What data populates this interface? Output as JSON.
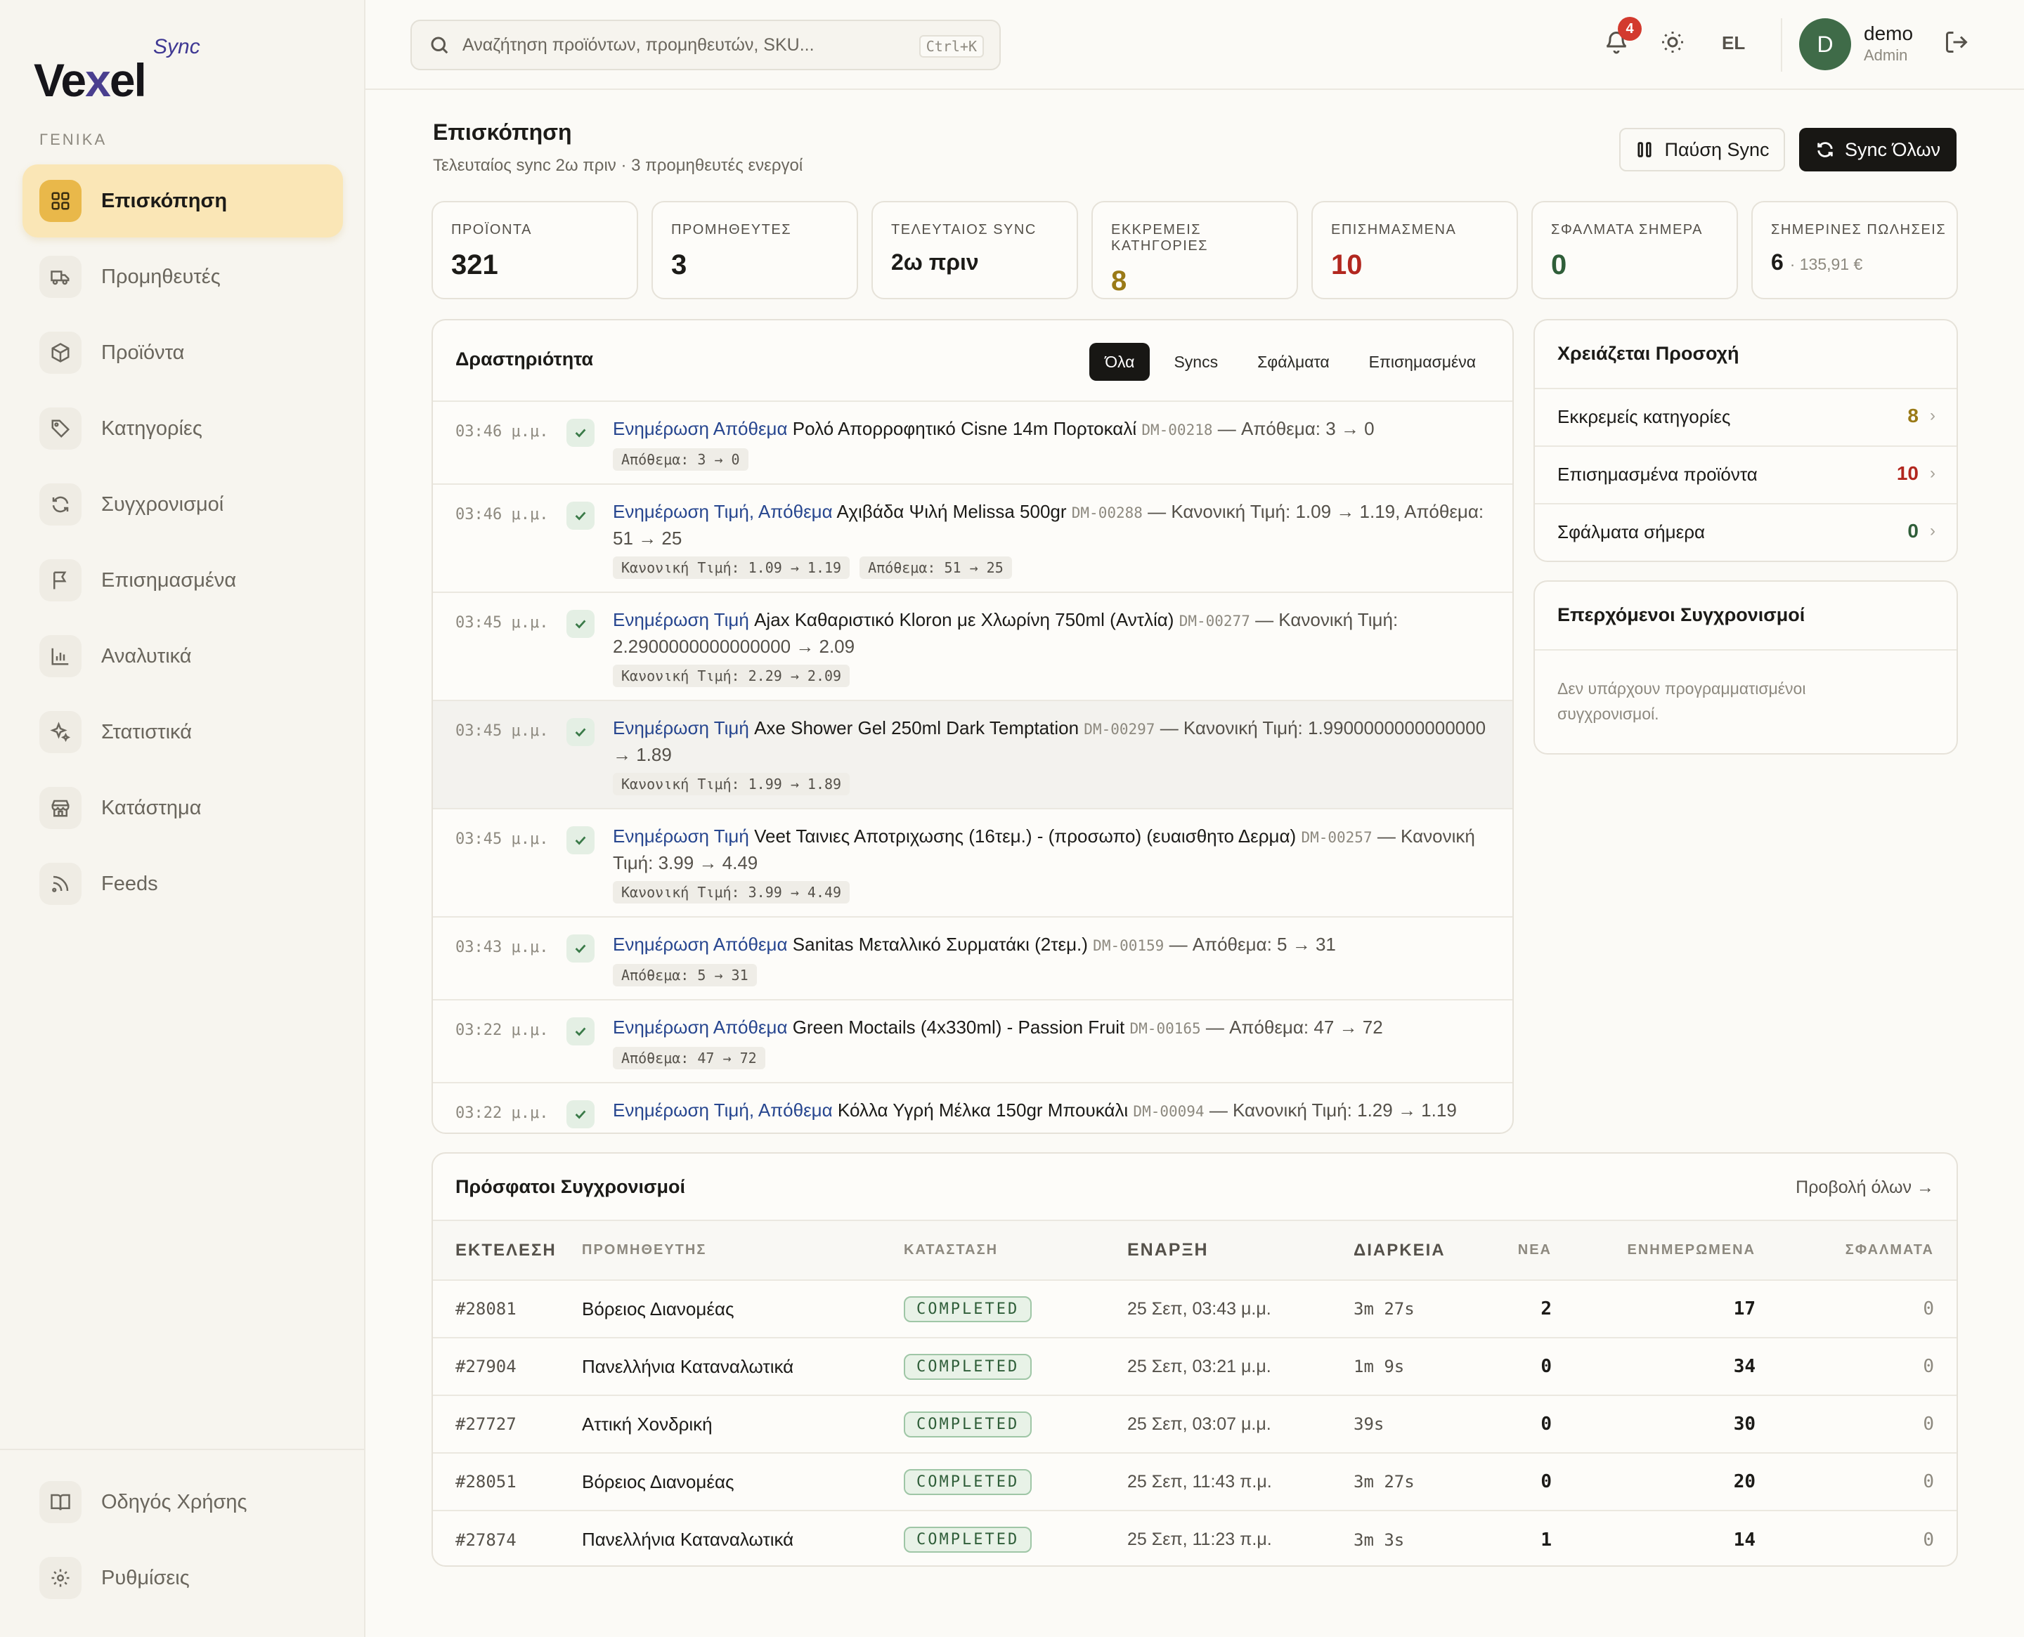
{
  "app": {
    "brand": "Vexel",
    "brand_suffix": "Sync"
  },
  "sidebar": {
    "section": "ΓΕΝΙΚΑ",
    "items": [
      {
        "label": "Επισκόπηση",
        "icon": "grid-icon"
      },
      {
        "label": "Προμηθευτές",
        "icon": "truck-icon"
      },
      {
        "label": "Προϊόντα",
        "icon": "box-icon"
      },
      {
        "label": "Κατηγορίες",
        "icon": "tag-icon"
      },
      {
        "label": "Συγχρονισμοί",
        "icon": "refresh-icon"
      },
      {
        "label": "Επισημασμένα",
        "icon": "flag-icon"
      },
      {
        "label": "Αναλυτικά",
        "icon": "bar-chart-icon"
      },
      {
        "label": "Στατιστικά",
        "icon": "sparkle-icon"
      },
      {
        "label": "Κατάστημα",
        "icon": "store-icon"
      },
      {
        "label": "Feeds",
        "icon": "rss-icon"
      }
    ],
    "bottom": [
      {
        "label": "Οδηγός Χρήσης",
        "icon": "book-icon"
      },
      {
        "label": "Ρυθμίσεις",
        "icon": "gear-icon"
      }
    ]
  },
  "topbar": {
    "search_placeholder": "Αναζήτηση προϊόντων, προμηθευτών, SKU...",
    "search_shortcut": "Ctrl+K",
    "notification_count": "4",
    "language": "EL",
    "avatar_initial": "D",
    "user_name": "demo",
    "user_role": "Admin"
  },
  "header": {
    "title": "Επισκόπηση",
    "subtitle": "Τελευταίος sync 2ω πριν · 3 προμηθευτές ενεργοί",
    "pause_label": "Παύση Sync",
    "sync_all_label": "Sync Όλων"
  },
  "stats": [
    {
      "label": "ΠΡΟΪΟΝΤΑ",
      "value": "321",
      "color": "#1c1b18"
    },
    {
      "label": "ΠΡΟΜΗΘΕΥΤΕΣ",
      "value": "3",
      "color": "#1c1b18"
    },
    {
      "label": "ΤΕΛΕΥΤΑΙΟΣ SYNC",
      "value": "2ω πριν",
      "color": "#1c1b18"
    },
    {
      "label": "ΕΚΚΡΕΜΕΙΣ ΚΑΤΗΓΟΡΙΕΣ",
      "value": "8",
      "color": "#9a7a17"
    },
    {
      "label": "ΕΠΙΣΗΜΑΣΜΕΝΑ",
      "value": "10",
      "color": "#b2271f"
    },
    {
      "label": "ΣΦΑΛΜΑΤΑ ΣΗΜΕΡΑ",
      "value": "0",
      "color": "#2f5e39"
    },
    {
      "label": "ΣΗΜΕΡΙΝΕΣ ΠΩΛΗΣΕΙΣ",
      "value": "6",
      "extra": "· 135,91 €",
      "color": "#1c1b18"
    }
  ],
  "activity": {
    "title": "Δραστηριότητα",
    "filters": [
      "Όλα",
      "Syncs",
      "Σφάλματα",
      "Επισημασμένα"
    ],
    "rows": [
      {
        "time": "03:46 μ.μ.",
        "type": "Ενημέρωση Απόθεμα",
        "product": "Ρολό Απορροφητικό Cisne 14m Πορτοκαλί",
        "sku": "DM-00218",
        "desc": "— Απόθεμα: 3 → 0",
        "chips": [
          "Απόθεμα: 3 → 0"
        ]
      },
      {
        "time": "03:46 μ.μ.",
        "type": "Ενημέρωση Τιμή, Απόθεμα",
        "product": "Αχιβάδα Ψιλή Melissa 500gr",
        "sku": "DM-00288",
        "desc": "— Κανονική Τιμή: 1.09 → 1.19, Απόθεμα: 51 → 25",
        "chips": [
          "Κανονική Τιμή: 1.09 → 1.19",
          "Απόθεμα: 51 → 25"
        ]
      },
      {
        "time": "03:45 μ.μ.",
        "type": "Ενημέρωση Τιμή",
        "product": "Ajax Καθαριστικό Kloron με Χλωρίνη 750ml (Αντλία)",
        "sku": "DM-00277",
        "desc": "— Κανονική Τιμή: 2.2900000000000000 → 2.09",
        "chips": [
          "Κανονική Τιμή: 2.29 → 2.09"
        ]
      },
      {
        "time": "03:45 μ.μ.",
        "type": "Ενημέρωση Τιμή",
        "product": "Axe Shower Gel 250ml Dark Temptation",
        "sku": "DM-00297",
        "desc": "— Κανονική Τιμή: 1.9900000000000000 → 1.89",
        "chips": [
          "Κανονική Τιμή: 1.99 → 1.89"
        ]
      },
      {
        "time": "03:45 μ.μ.",
        "type": "Ενημέρωση Τιμή",
        "product": "Veet Ταινιες Αποτριχωσης (16τεμ.) - (προσωπο) (ευαισθητο Δερμα)",
        "sku": "DM-00257",
        "desc": "— Κανονική Τιμή: 3.99 → 4.49",
        "chips": [
          "Κανονική Τιμή: 3.99 → 4.49"
        ]
      },
      {
        "time": "03:43 μ.μ.",
        "type": "Ενημέρωση Απόθεμα",
        "product": "Sanitas Μεταλλικό Συρματάκι (2τεμ.)",
        "sku": "DM-00159",
        "desc": "— Απόθεμα: 5 → 31",
        "chips": [
          "Απόθεμα: 5 → 31"
        ]
      },
      {
        "time": "03:22 μ.μ.",
        "type": "Ενημέρωση Απόθεμα",
        "product": "Green Moctails (4x330ml) - Passion Fruit",
        "sku": "DM-00165",
        "desc": "— Απόθεμα: 47 → 72",
        "chips": [
          "Απόθεμα: 47 → 72"
        ]
      },
      {
        "time": "03:22 μ.μ.",
        "type": "Ενημέρωση Τιμή, Απόθεμα",
        "product": "Κόλλα Υγρή Μέλκα 150gr Μπουκάλι",
        "sku": "DM-00094",
        "desc": "— Κανονική Τιμή: 1.29 → 1.19",
        "chips": []
      }
    ]
  },
  "attention": {
    "title": "Χρειάζεται Προσοχή",
    "rows": [
      {
        "label": "Εκκρεμείς κατηγορίες",
        "value": "8",
        "color": "#9a7a17"
      },
      {
        "label": "Επισημασμένα προϊόντα",
        "value": "10",
        "color": "#b2271f"
      },
      {
        "label": "Σφάλματα σήμερα",
        "value": "0",
        "color": "#2f5e39"
      }
    ]
  },
  "upcoming": {
    "title": "Επερχόμενοι Συγχρονισμοί",
    "empty_text": "Δεν υπάρχουν προγραμματισμένοι συγχρονισμοί."
  },
  "recent": {
    "title": "Πρόσφατοι Συγχρονισμοί",
    "view_all": "Προβολή όλων →",
    "columns": [
      "ΕΚΤΕΛΕΣΗ",
      "ΠΡΟΜΗΘΕΥΤΗΣ",
      "ΚΑΤΑΣΤΑΣΗ",
      "ΕΝΑΡΞΗ",
      "ΔΙΑΡΚΕΙΑ",
      "ΝΕΑ",
      "ΕΝΗΜΕΡΩΜΕΝΑ",
      "ΣΦΑΛΜΑΤΑ"
    ],
    "rows": [
      {
        "run": "#28081",
        "supplier": "Βόρειος Διανομέας",
        "status": "COMPLETED",
        "start": "25 Σεπ, 03:43 μ.μ.",
        "duration": "3m 27s",
        "new": "2",
        "updated": "17",
        "errors": "0"
      },
      {
        "run": "#27904",
        "supplier": "Πανελλήνια Καταναλωτικά",
        "status": "COMPLETED",
        "start": "25 Σεπ, 03:21 μ.μ.",
        "duration": "1m 9s",
        "new": "0",
        "updated": "34",
        "errors": "0"
      },
      {
        "run": "#27727",
        "supplier": "Αττική Χονδρική",
        "status": "COMPLETED",
        "start": "25 Σεπ, 03:07 μ.μ.",
        "duration": "39s",
        "new": "0",
        "updated": "30",
        "errors": "0"
      },
      {
        "run": "#28051",
        "supplier": "Βόρειος Διανομέας",
        "status": "COMPLETED",
        "start": "25 Σεπ, 11:43 π.μ.",
        "duration": "3m 27s",
        "new": "0",
        "updated": "20",
        "errors": "0"
      },
      {
        "run": "#27874",
        "supplier": "Πανελλήνια Καταναλωτικά",
        "status": "COMPLETED",
        "start": "25 Σεπ, 11:23 π.μ.",
        "duration": "3m 3s",
        "new": "1",
        "updated": "14",
        "errors": "0"
      }
    ]
  }
}
